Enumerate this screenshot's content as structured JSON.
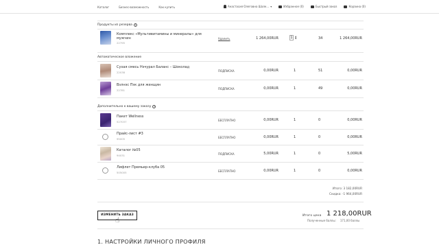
{
  "topbar": {
    "nav": [
      "Каталог",
      "Бизнес-возможность",
      "Как купить"
    ],
    "user_name": "Анастасия Олеговна Шалк...",
    "favorites": "Избранное (0)",
    "quick_order": "Быстрый заказ",
    "cart": "Корзина (0)"
  },
  "reserve": {
    "heading": "Продукты из резерва",
    "items": [
      {
        "name_line1": "Комплекс «Мультивитамины и минералы» для",
        "name_line2": "мужчин",
        "code": "22795",
        "type": "Удалить",
        "price": "1 264,00RUR",
        "qty": "1",
        "points": "34",
        "total": "1 264,00RUR"
      }
    ]
  },
  "auto": {
    "heading": "Автоматическое вложение",
    "items": [
      {
        "name": "Сухая смесь Нэчурал Баланс – Шоколад",
        "code": "22038",
        "type": "ПОДПИСКА",
        "price": "0,00RUR",
        "qty": "1",
        "points": "51",
        "total": "0,00RUR"
      },
      {
        "name": "Вэлнэс Пэк для женщин",
        "code": "22781",
        "type": "ПОДПИСКА",
        "price": "0,00RUR",
        "qty": "1",
        "points": "49",
        "total": "0,00RUR"
      }
    ]
  },
  "extra": {
    "heading": "Дополнительно к вашему заказу",
    "items": [
      {
        "name": "Пакет Wellness",
        "code": "527037",
        "type": "БЕСПЛАТНО",
        "price": "0,00RUR",
        "qty": "1",
        "points": "0",
        "total": "0,00RUR"
      },
      {
        "name": "Прайс-лист #3",
        "code": "95005",
        "type": "БЕСПЛАТНО",
        "price": "0,00RUR",
        "qty": "1",
        "points": "0",
        "total": "0,00RUR"
      },
      {
        "name": "Каталог №05",
        "code": "94031",
        "type": "ПОДПИСКА",
        "price": "5,00RUR",
        "qty": "1",
        "points": "0",
        "total": "5,00RUR"
      },
      {
        "name": "Лифлет Премьер-клуба 05",
        "code": "505005",
        "type": "БЕСПЛАТНО",
        "price": "0,00RUR",
        "qty": "1",
        "points": "0",
        "total": "0,00RUR"
      }
    ]
  },
  "summary": {
    "subtotal": "Итого:  3 182,00RUR",
    "discount": "Скидка:  -1 964,00RUR"
  },
  "change_order_label": "ИЗМЕНИТЬ ЗАКАЗ",
  "order_total": {
    "label": "Итого цена",
    "value": "1 218,00RUR",
    "bonus_label": "Полученные баллы:",
    "bonus_value": "171,00 баллы"
  },
  "profile_heading": "1. НАСТРОЙКИ ЛИЧНОГО ПРОФИЛЯ",
  "colors": {
    "text": "#333333",
    "rule": "#e3e3e3",
    "button_border": "#222222"
  }
}
